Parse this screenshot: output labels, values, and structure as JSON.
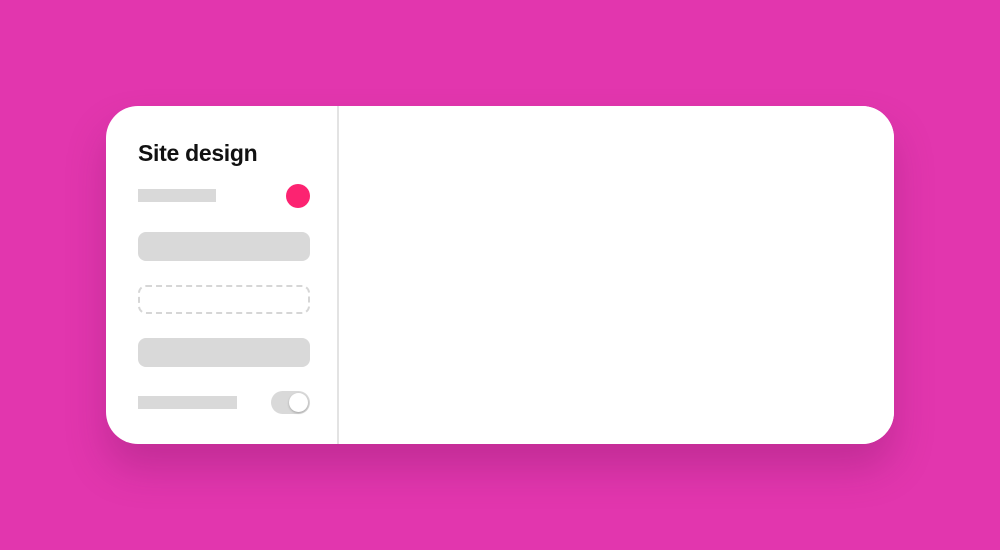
{
  "panel": {
    "title": "Site design"
  },
  "theme": {
    "background": "#e236ae",
    "card": "#ffffff",
    "placeholder": "#d9d9d9",
    "accent_color": "#fc2371"
  },
  "controls": {
    "color_swatch": {
      "value": "#fc2371"
    },
    "toggle": {
      "state": "on"
    }
  }
}
